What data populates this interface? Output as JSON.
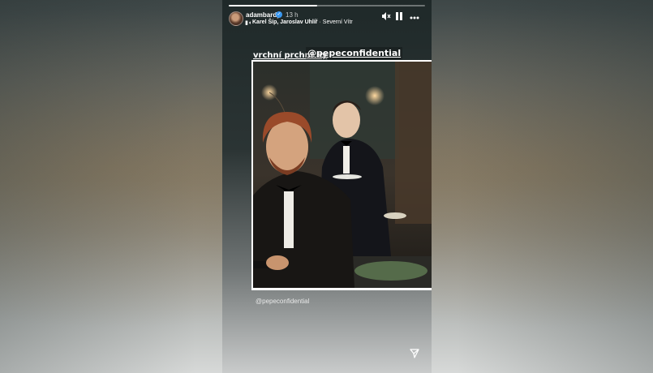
{
  "story": {
    "username": "adambardy",
    "verified_badge": "✓",
    "time": "13 h",
    "progress": 0.45,
    "music": {
      "icon": "music-bars-icon",
      "artists": "Karel Šíp, Jaroslav Uhlíř",
      "separator": " · ",
      "song": "Severní Vítr"
    },
    "controls": {
      "mute_icon": "speaker-muted-icon",
      "pause_icon": "pause-icon",
      "more_icon": "more-icon"
    },
    "credit_label": "vrchní prchní by",
    "credit_mention": "@pepeconfidential",
    "mention_sticker": "@pepeconfidential",
    "share_icon": "send-icon"
  }
}
